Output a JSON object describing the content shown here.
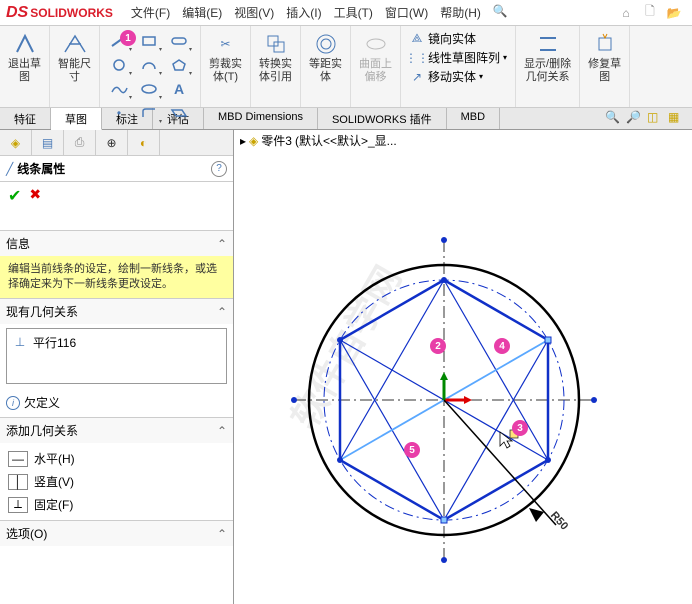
{
  "app": {
    "logo_text": "SOLIDWORKS"
  },
  "menu": {
    "file": "文件(F)",
    "edit": "编辑(E)",
    "view": "视图(V)",
    "insert": "插入(I)",
    "tools": "工具(T)",
    "window": "窗口(W)",
    "help": "帮助(H)"
  },
  "ribbon": {
    "exit_sketch": "退出草\n图",
    "smart_dim": "智能尺\n寸",
    "trim": "剪裁实\n体(T)",
    "convert": "转换实\n体引用",
    "offset": "等距实\n体",
    "on_surface": "曲面上\n偏移",
    "mirror": "镜向实体",
    "linear_pattern": "线性草图阵列",
    "move": "移动实体",
    "show_rel": "显示/删除\n几何关系",
    "repair": "修复草\n图"
  },
  "tabs": {
    "feature": "特征",
    "sketch": "草图",
    "annotate": "标注",
    "evaluate": "评估",
    "mbd": "MBD Dimensions",
    "addins": "SOLIDWORKS 插件",
    "mbd2": "MBD"
  },
  "panel": {
    "title": "线条属性",
    "info_head": "信息",
    "info_text": "编辑当前线条的设定，绘制一新线条，或选择确定来为下一新线条更改设定。",
    "existing_head": "现有几何关系",
    "rel_item": "平行116",
    "status": "欠定义",
    "add_head": "添加几何关系",
    "horiz": "水平(H)",
    "vert": "竖直(V)",
    "fixed": "固定(F)",
    "options_head": "选项(O)"
  },
  "crumb": {
    "part": "零件3",
    "state": "(默认<<默认>_显..."
  },
  "geom": {
    "radius_label": "R50"
  },
  "badges": {
    "b1": "1",
    "b2": "2",
    "b3": "3",
    "b4": "4",
    "b5": "5"
  },
  "watermark": "软件自学网"
}
